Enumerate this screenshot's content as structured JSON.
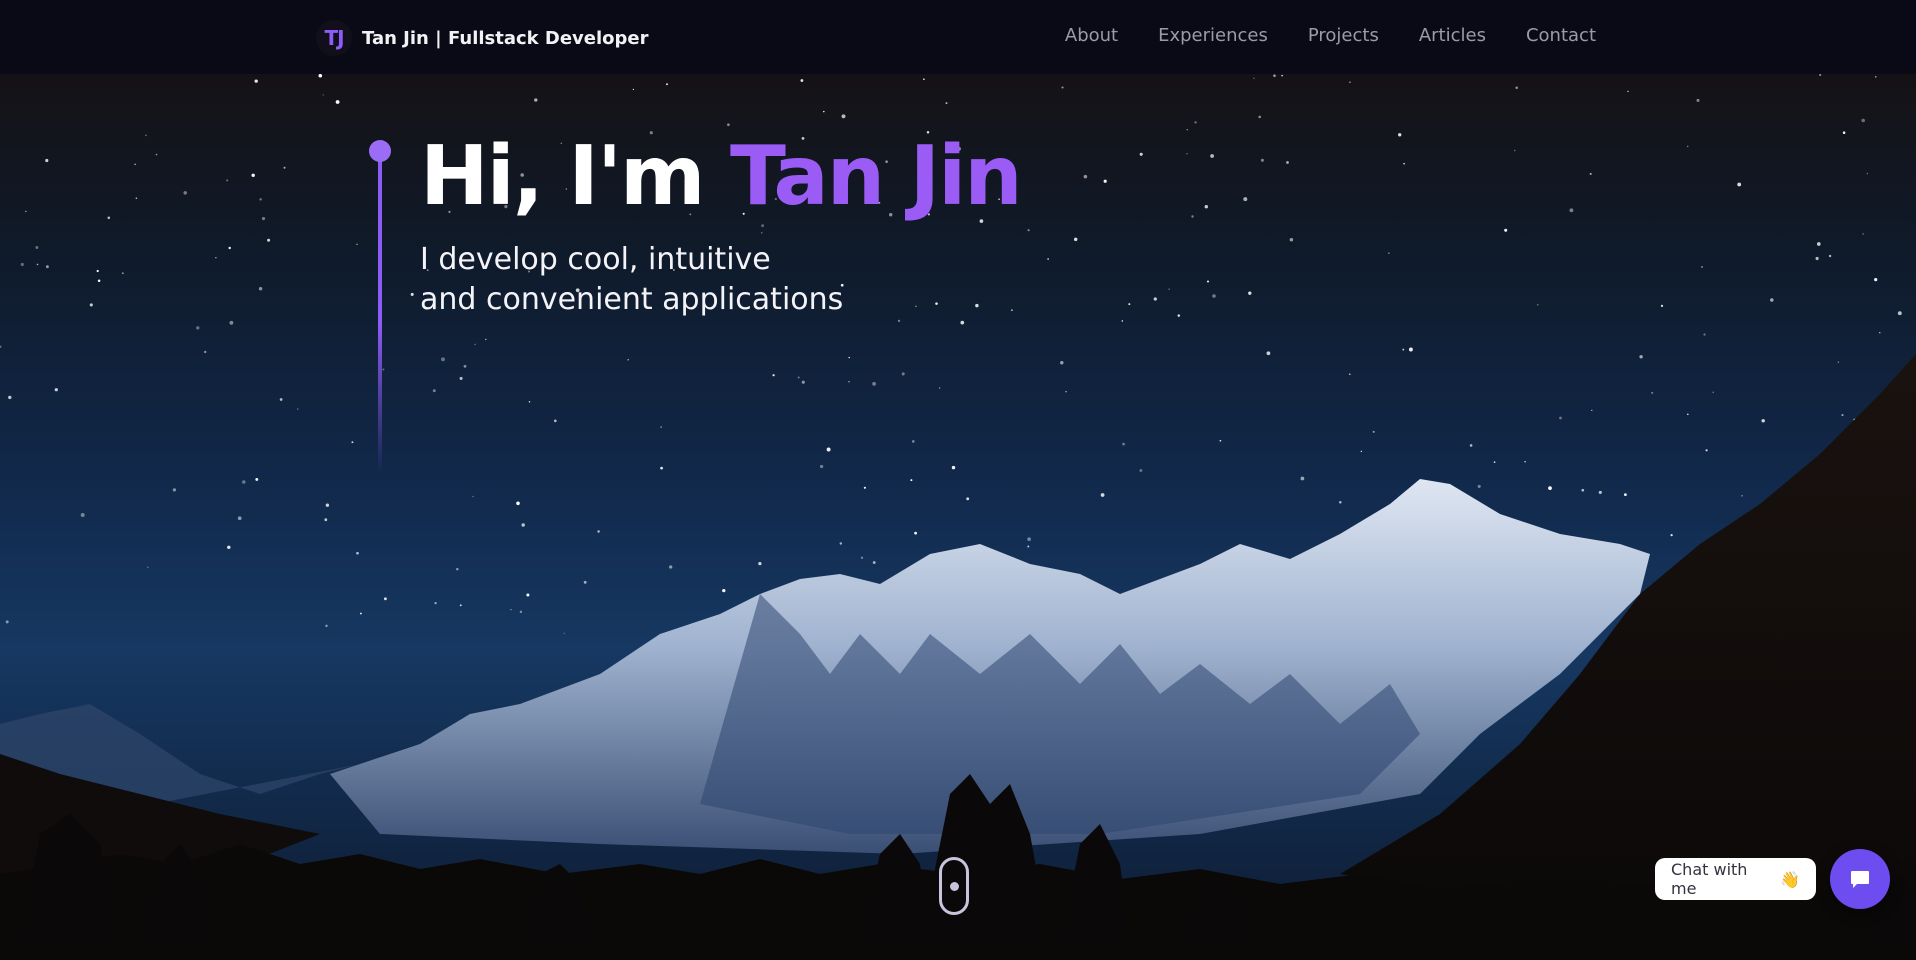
{
  "header": {
    "logo_mark": "TJ",
    "logo_text": "Tan Jin  | Fullstack Developer",
    "nav": [
      {
        "label": "About"
      },
      {
        "label": "Experiences"
      },
      {
        "label": "Projects"
      },
      {
        "label": "Articles"
      },
      {
        "label": "Contact"
      }
    ]
  },
  "hero": {
    "title_prefix": "Hi, I'm ",
    "title_name": "Tan Jin",
    "subtitle_line1": "I develop cool, intuitive",
    "subtitle_line2": "and convenient applications"
  },
  "chat": {
    "label": "Chat with me",
    "emoji": "👋",
    "icon": "chat-bubble-icon"
  },
  "scroll_indicator": {
    "icon": "mouse-scroll-icon"
  },
  "colors": {
    "accent": "#8b5cf6",
    "header_bg": "#0a0a17",
    "chat_button": "#6d4df0"
  }
}
